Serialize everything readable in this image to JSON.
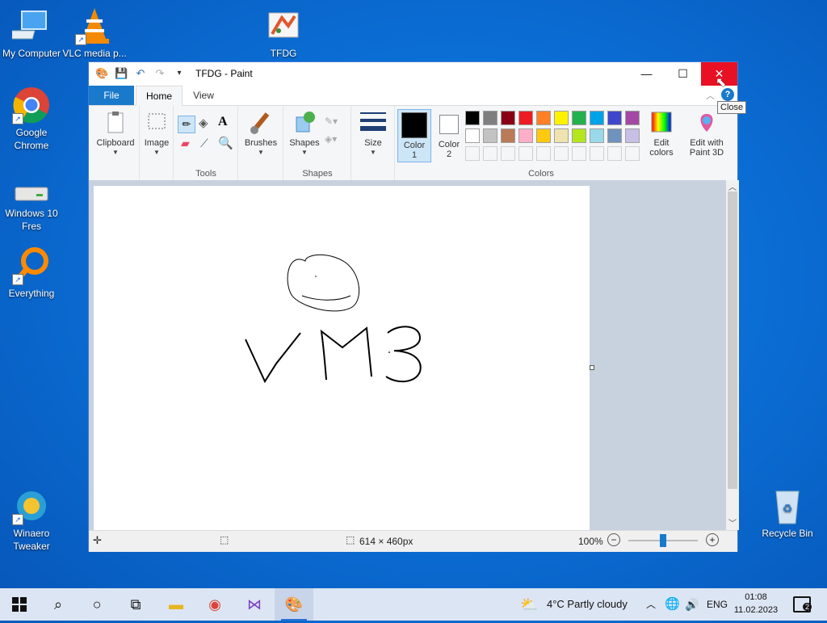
{
  "desktop": {
    "icons": [
      {
        "label": "My Computer"
      },
      {
        "label": "VLC media p..."
      },
      {
        "label": "TFDG"
      },
      {
        "label": "Google Chrome"
      },
      {
        "label": "Windows 10 Fres"
      },
      {
        "label": "Everything"
      },
      {
        "label": "Winaero Tweaker"
      },
      {
        "label": "Recycle Bin"
      }
    ]
  },
  "window": {
    "title": "TFDG - Paint",
    "tooltip": "Close",
    "tabs": {
      "file": "File",
      "home": "Home",
      "view": "View"
    },
    "ribbon": {
      "clipboard": "Clipboard",
      "image": "Image",
      "tools": "Tools",
      "brushes": "Brushes",
      "shapes": "Shapes",
      "shapes_group": "Shapes",
      "size": "Size",
      "color1": "Color\n1",
      "color1_line1": "Color",
      "color1_line2": "1",
      "color2_line1": "Color",
      "color2_line2": "2",
      "colors_group": "Colors",
      "edit_colors_line1": "Edit",
      "edit_colors_line2": "colors",
      "paint3d_line1": "Edit with",
      "paint3d_line2": "Paint 3D"
    },
    "palette_row1": [
      "#000000",
      "#7f7f7f",
      "#880015",
      "#ed1c24",
      "#ff7f27",
      "#fff200",
      "#22b14c",
      "#00a2e8",
      "#3f48cc",
      "#a349a4"
    ],
    "palette_row2": [
      "#ffffff",
      "#c3c3c3",
      "#b97a57",
      "#ffaec9",
      "#ffc90e",
      "#efe4b0",
      "#b5e61d",
      "#99d9ea",
      "#7092be",
      "#c8bfe7"
    ],
    "canvas_text": "VM3",
    "status": {
      "size": "614 × 460px",
      "zoom": "100%",
      "zoom_level": 0.5
    }
  },
  "taskbar": {
    "weather": "4°C  Partly cloudy",
    "lang": "ENG",
    "time": "01:08",
    "date": "11.02.2023",
    "notifications": "2"
  }
}
